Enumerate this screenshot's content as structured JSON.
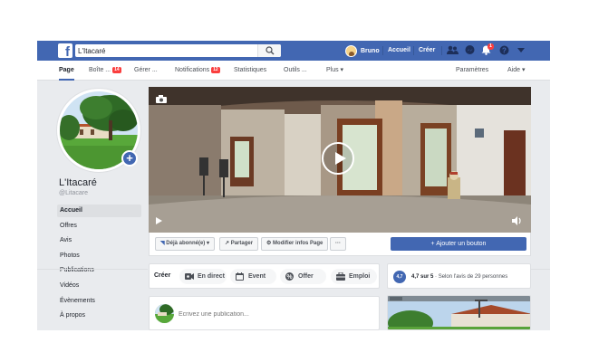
{
  "topbar": {
    "search_value": "L'Itacaré",
    "user_name": "Bruno",
    "nav_home": "Accueil",
    "nav_create": "Créer",
    "notifications_count": "1",
    "brand_color": "#4267b2"
  },
  "page_tabs": [
    {
      "label": "Page"
    },
    {
      "label": "Boîte ...",
      "count": "14"
    },
    {
      "label": "Gérer ..."
    },
    {
      "label": "Notifications",
      "count": "12"
    },
    {
      "label": "Statistiques"
    },
    {
      "label": "Outils ..."
    },
    {
      "label": "Plus ▾"
    },
    {
      "label": "Paramètres"
    },
    {
      "label": "Aide ▾"
    }
  ],
  "profile": {
    "name": "L'Itacaré",
    "handle": "@Litacare"
  },
  "left_nav": [
    {
      "label": "Accueil"
    },
    {
      "label": "Offres"
    },
    {
      "label": "Avis"
    },
    {
      "label": "Photos"
    },
    {
      "label": "Publications"
    },
    {
      "label": "Vidéos"
    },
    {
      "label": "Évènements"
    },
    {
      "label": "À propos"
    }
  ],
  "actions": {
    "subscribed": "Déjà abonné(e) ▾",
    "share": "Partager",
    "edit_page": "Modifier infos Page",
    "more": "···",
    "add_button": "Ajouter un bouton"
  },
  "create": {
    "label": "Créer",
    "live": "En direct",
    "event": "Event",
    "offer": "Offer",
    "job": "Emploi"
  },
  "composer": {
    "placeholder": "Écrivez une publication..."
  },
  "rating": {
    "score": "4,7",
    "score_text": "4,7 sur 5",
    "reviews_text": "Selon l'avis de 29 personnes"
  }
}
